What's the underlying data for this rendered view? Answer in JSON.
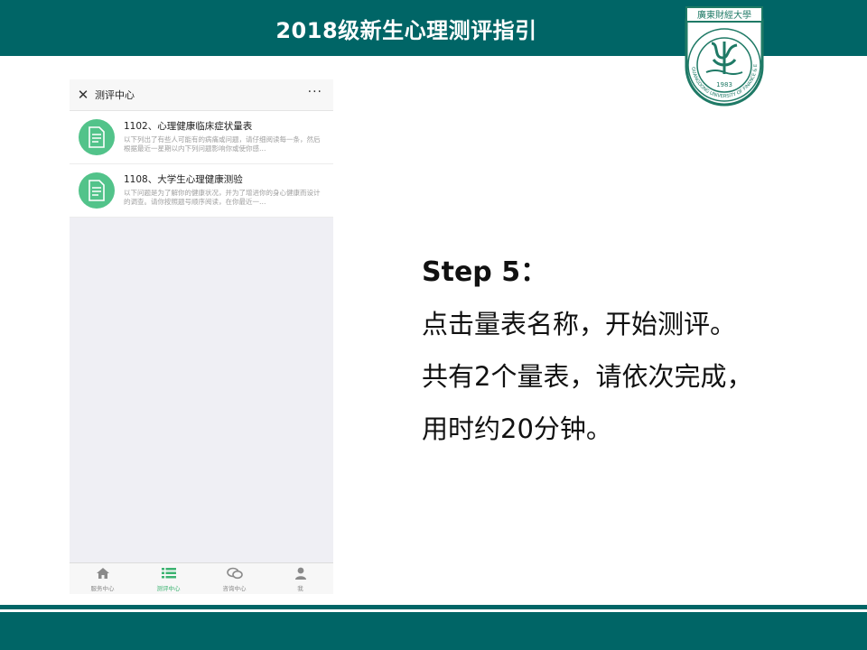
{
  "header": {
    "title": "2018级新生心理测评指引",
    "logo": {
      "top_text": "廣東財經大學",
      "ring_text": "GUANGDONG UNIVERSITY OF FINANCE & ECONOMICS",
      "year": "1983"
    }
  },
  "phone": {
    "nav": {
      "close_icon": "✕",
      "title": "测评中心",
      "more": "···"
    },
    "items": [
      {
        "title": "1102、心理健康临床症状量表",
        "desc": "以下列出了有些人可能有的病痛或问题，请仔细阅读每一条，然后根据最近一星期以内下列问题影响你或使你感…"
      },
      {
        "title": "1108、大学生心理健康测验",
        "desc": "以下问题是为了解你的健康状况，并为了增进你的身心健康而设计的调查。请你按照题号顺序阅读，在你最近一…"
      }
    ],
    "tabs": [
      {
        "label": "服务中心",
        "icon": "home-icon"
      },
      {
        "label": "测评中心",
        "icon": "list-icon"
      },
      {
        "label": "咨询中心",
        "icon": "chat-icon"
      },
      {
        "label": "我",
        "icon": "user-icon"
      }
    ]
  },
  "step": {
    "heading": "Step 5：",
    "lines": [
      "点击量表名称，开始测评。",
      "共有2个量表，请依次完成，",
      "用时约20分钟。"
    ]
  },
  "colors": {
    "brand_teal": "#006566",
    "accent_green": "#3cb371",
    "icon_green": "#52c38a"
  }
}
